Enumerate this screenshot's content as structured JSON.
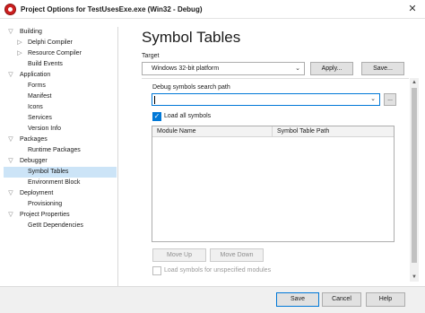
{
  "window": {
    "title": "Project Options for TestUsesExe.exe  (Win32 - Debug)",
    "close_glyph": "✕"
  },
  "tree": {
    "items": [
      {
        "label": "Building",
        "arrow": "▽"
      },
      {
        "label": "Delphi Compiler",
        "arrow": "▷"
      },
      {
        "label": "Resource Compiler",
        "arrow": "▷"
      },
      {
        "label": "Build Events",
        "arrow": ""
      },
      {
        "label": "Application",
        "arrow": "▽"
      },
      {
        "label": "Forms",
        "arrow": ""
      },
      {
        "label": "Manifest",
        "arrow": ""
      },
      {
        "label": "Icons",
        "arrow": ""
      },
      {
        "label": "Services",
        "arrow": ""
      },
      {
        "label": "Version Info",
        "arrow": ""
      },
      {
        "label": "Packages",
        "arrow": "▽"
      },
      {
        "label": "Runtime Packages",
        "arrow": ""
      },
      {
        "label": "Debugger",
        "arrow": "▽"
      },
      {
        "label": "Symbol Tables",
        "arrow": ""
      },
      {
        "label": "Environment Block",
        "arrow": ""
      },
      {
        "label": "Deployment",
        "arrow": "▽"
      },
      {
        "label": "Provisioning",
        "arrow": ""
      },
      {
        "label": "Project Properties",
        "arrow": "▽"
      },
      {
        "label": "GetIt Dependencies",
        "arrow": ""
      }
    ],
    "selected_label": "Symbol Tables"
  },
  "main": {
    "heading": "Symbol Tables",
    "target_label": "Target",
    "target_value": "Windows 32-bit platform",
    "apply_label": "Apply...",
    "save_label": "Save...",
    "debug_path_label": "Debug symbols search path",
    "debug_path_value": "",
    "browse_label": "...",
    "load_all_label": "Load all symbols",
    "load_all_checked": true,
    "columns": [
      "Module Name",
      "Symbol Table Path"
    ],
    "rows": [],
    "move_up_label": "Move Up",
    "move_down_label": "Move Down",
    "load_unspecified_label": "Load symbols for unspecified modules",
    "load_unspecified_checked": false
  },
  "footer": {
    "save_label": "Save",
    "cancel_label": "Cancel",
    "help_label": "Help"
  },
  "colors": {
    "accent": "#0078d7",
    "selection": "#cce4f7",
    "logo": "#cc1f1f"
  }
}
